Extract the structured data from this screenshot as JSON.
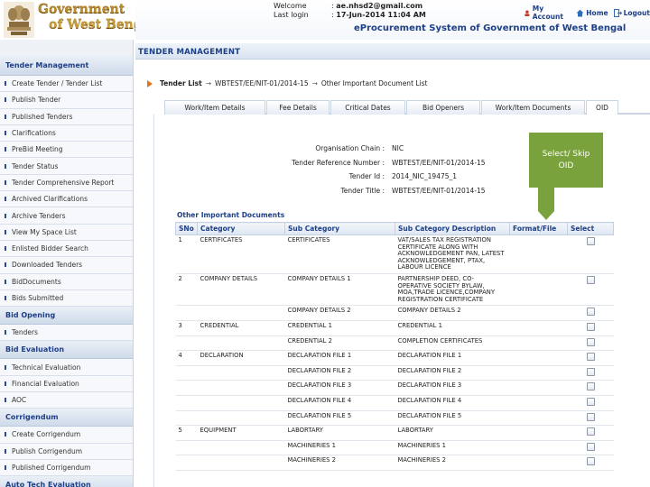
{
  "header": {
    "brand_line1": "Government",
    "brand_line2": "of West Bengal",
    "welcome_label": "Welcome",
    "welcome_value": "ae.nhsd2@gmail.com",
    "lastlogin_label": "Last login",
    "lastlogin_value": "17-Jun-2014 11:04 AM",
    "system_title": "eProcurement System of Government of West Bengal",
    "links": {
      "my_account": "My Account",
      "home": "Home",
      "logout": "Logout"
    }
  },
  "sidebar": {
    "sections": [
      {
        "title": "Tender Management",
        "items": [
          "Create Tender / Tender List",
          "Publish Tender",
          "Published Tenders",
          "Clarifications",
          "PreBid Meeting",
          "Tender Status",
          "Tender Comprehensive Report",
          "Archived Clarifications",
          "Archive Tenders",
          "View My Space List",
          "Enlisted Bidder Search",
          "Downloaded Tenders",
          "BidDocuments",
          "Bids Submitted"
        ]
      },
      {
        "title": "Bid Opening",
        "items": [
          "Tenders"
        ]
      },
      {
        "title": "Bid Evaluation",
        "items": [
          "Technical Evaluation",
          "Financial Evaluation",
          "AOC"
        ]
      },
      {
        "title": "Corrigendum",
        "items": [
          "Create Corrigendum",
          "Publish Corrigendum",
          "Published Corrigendum"
        ]
      },
      {
        "title": "Auto Tech Evaluation",
        "items": []
      }
    ]
  },
  "main": {
    "title": "TENDER MANAGEMENT",
    "breadcrumb": [
      "Tender List",
      "WBTEST/EE/NIT-01/2014-15",
      "Other Important Document List"
    ],
    "tabs": [
      "Work/Item Details",
      "Fee Details",
      "Critical Dates",
      "Bid Openers",
      "Work/Item Documents",
      "OID"
    ],
    "active_tab": "OID",
    "org_info": [
      {
        "label": "Organisation Chain :",
        "value": "NIC"
      },
      {
        "label": "Tender Reference Number :",
        "value": "WBTEST/EE/NIT-01/2014-15"
      },
      {
        "label": "Tender Id :",
        "value": "2014_NIC_19475_1"
      },
      {
        "label": "Tender Title :",
        "value": "WBTEST/EE/NIT-01/2014-15"
      }
    ],
    "tooltip": {
      "line1": "Select/ Skip",
      "line2": "OID"
    },
    "docs_section_title": "Other Important Documents",
    "columns": [
      "SNo",
      "Category",
      "Sub Category",
      "Sub Category Description",
      "Format/File",
      "Select"
    ],
    "rows": [
      {
        "sno": "1",
        "category": "CERTIFICATES",
        "sub_category": "CERTIFICATES",
        "description": "VAT/SALES TAX REGISTRATION CERTIFICATE ALONG WITH ACKNOWLEDGEMENT PAN, LATEST ACKNOWLEDGEMENT, PTAX, LABOUR LICENCE"
      },
      {
        "sno": "2",
        "category": "COMPANY DETAILS",
        "sub_category": "COMPANY DETAILS 1",
        "description": "PARTNERSHIP DEED, CO-OPERATIVE SOCIETY BYLAW, MOA,TRADE LICENCE,COMPANY REGISTRATION CERTIFICATE"
      },
      {
        "sno": "",
        "category": "",
        "sub_category": "COMPANY DETAILS 2",
        "description": "COMPANY DETAILS 2"
      },
      {
        "sno": "3",
        "category": "CREDENTIAL",
        "sub_category": "CREDENTIAL 1",
        "description": "CREDENTIAL 1"
      },
      {
        "sno": "",
        "category": "",
        "sub_category": "CREDENTIAL 2",
        "description": "COMPLETION CERTIFICATES"
      },
      {
        "sno": "4",
        "category": "DECLARATION",
        "sub_category": "DECLARATION FILE 1",
        "description": "DECLARATION FILE 1"
      },
      {
        "sno": "",
        "category": "",
        "sub_category": "DECLARATION FILE 2",
        "description": "DECLARATION FILE 2"
      },
      {
        "sno": "",
        "category": "",
        "sub_category": "DECLARATION FILE 3",
        "description": "DECLARATION FILE 3"
      },
      {
        "sno": "",
        "category": "",
        "sub_category": "DECLARATION FILE 4",
        "description": "DECLARATION FILE 4"
      },
      {
        "sno": "",
        "category": "",
        "sub_category": "DECLARATION FILE 5",
        "description": "DECLARATION FILE 5"
      },
      {
        "sno": "5",
        "category": "EQUIPMENT",
        "sub_category": "LABORTARY",
        "description": "LABORTARY"
      },
      {
        "sno": "",
        "category": "",
        "sub_category": "MACHINERIES 1",
        "description": "MACHINERIES 1"
      },
      {
        "sno": "",
        "category": "",
        "sub_category": "MACHINERIES 2",
        "description": "MACHINERIES 2"
      }
    ]
  },
  "colors": {
    "accent": "#1d3f86",
    "tooltip": "#7aa23c",
    "brand_gold": "#c99d35",
    "arrow": "#e07520"
  }
}
